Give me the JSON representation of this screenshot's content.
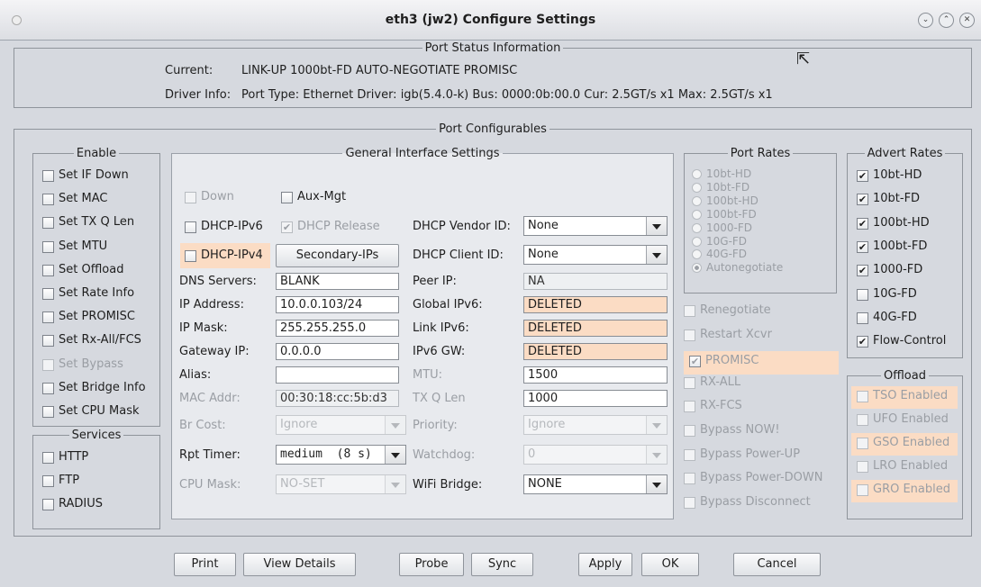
{
  "window": {
    "title": "eth3  (jw2) Configure Settings"
  },
  "status": {
    "section_title": "Port Status Information",
    "current_label": "Current:",
    "current_value": "LINK-UP 1000bt-FD AUTO-NEGOTIATE PROMISC",
    "driver_label": "Driver Info:",
    "driver_value": "Port Type: Ethernet   Driver: igb(5.4.0-k)  Bus: 0000:0b:00.0  Cur: 2.5GT/s x1   Max: 2.5GT/s x1"
  },
  "configurables": {
    "title": "Port Configurables"
  },
  "enable": {
    "title": "Enable",
    "items": [
      {
        "label": "Set IF Down",
        "checked": false,
        "disabled": false
      },
      {
        "label": "Set MAC",
        "checked": false,
        "disabled": false
      },
      {
        "label": "Set TX Q Len",
        "checked": false,
        "disabled": false
      },
      {
        "label": "Set MTU",
        "checked": false,
        "disabled": false
      },
      {
        "label": "Set Offload",
        "checked": false,
        "disabled": false
      },
      {
        "label": "Set Rate Info",
        "checked": false,
        "disabled": false
      },
      {
        "label": "Set PROMISC",
        "checked": false,
        "disabled": false
      },
      {
        "label": "Set Rx-All/FCS",
        "checked": false,
        "disabled": false
      },
      {
        "label": "Set Bypass",
        "checked": false,
        "disabled": true
      },
      {
        "label": "Set Bridge Info",
        "checked": false,
        "disabled": false
      },
      {
        "label": "Set CPU Mask",
        "checked": false,
        "disabled": false
      }
    ]
  },
  "services": {
    "title": "Services",
    "items": [
      {
        "label": "HTTP",
        "checked": false
      },
      {
        "label": "FTP",
        "checked": false
      },
      {
        "label": "RADIUS",
        "checked": false
      }
    ]
  },
  "general": {
    "title": "General Interface Settings",
    "down_label": "Down",
    "aux_mgt_label": "Aux-Mgt",
    "dhcp_ipv6_label": "DHCP-IPv6",
    "dhcp_release_label": "DHCP Release",
    "dhcp_vendor_label": "DHCP Vendor ID:",
    "dhcp_vendor_value": "None",
    "dhcp_ipv4_label": "DHCP-IPv4",
    "secondary_ips_label": "Secondary-IPs",
    "dhcp_client_label": "DHCP Client ID:",
    "dhcp_client_value": "None",
    "dns_label": "DNS Servers:",
    "dns_value": "BLANK",
    "peer_ip_label": "Peer IP:",
    "peer_ip_value": "NA",
    "ip_label": "IP Address:",
    "ip_value": "10.0.0.103/24",
    "global_ipv6_label": "Global IPv6:",
    "global_ipv6_value": "DELETED",
    "mask_label": "IP Mask:",
    "mask_value": "255.255.255.0",
    "link_ipv6_label": "Link IPv6:",
    "link_ipv6_value": "DELETED",
    "gw_label": "Gateway IP:",
    "gw_value": "0.0.0.0",
    "ipv6_gw_label": "IPv6 GW:",
    "ipv6_gw_value": "DELETED",
    "alias_label": "Alias:",
    "alias_value": "",
    "mtu_label": "MTU:",
    "mtu_value": "1500",
    "mac_label": "MAC Addr:",
    "mac_value": "00:30:18:cc:5b:d3",
    "txq_label": "TX Q Len",
    "txq_value": "1000",
    "br_cost_label": "Br Cost:",
    "br_cost_value": "Ignore",
    "priority_label": "Priority:",
    "priority_value": "Ignore",
    "rpt_timer_label": "Rpt Timer:",
    "rpt_timer_value": "medium  (8 s)",
    "watchdog_label": "Watchdog:",
    "watchdog_value": "0",
    "cpu_mask_label": "CPU Mask:",
    "cpu_mask_value": "NO-SET",
    "wifi_bridge_label": "WiFi Bridge:",
    "wifi_bridge_value": "NONE"
  },
  "port_rates": {
    "title": "Port Rates",
    "options": [
      "10bt-HD",
      "10bt-FD",
      "100bt-HD",
      "100bt-FD",
      "1000-FD",
      "10G-FD",
      "40G-FD",
      "Autonegotiate"
    ],
    "selected": "Autonegotiate"
  },
  "port_options": [
    {
      "label": "Renegotiate",
      "checked": false,
      "highlight": false
    },
    {
      "label": "Restart Xcvr",
      "checked": false,
      "highlight": false
    },
    {
      "label": "PROMISC",
      "checked": true,
      "highlight": true
    },
    {
      "label": "RX-ALL",
      "checked": false,
      "highlight": false
    },
    {
      "label": "RX-FCS",
      "checked": false,
      "highlight": false
    },
    {
      "label": "Bypass NOW!",
      "checked": false,
      "highlight": false
    },
    {
      "label": "Bypass Power-UP",
      "checked": false,
      "highlight": false
    },
    {
      "label": "Bypass Power-DOWN",
      "checked": false,
      "highlight": false
    },
    {
      "label": "Bypass Disconnect",
      "checked": false,
      "highlight": false
    }
  ],
  "advert_rates": {
    "title": "Advert Rates",
    "items": [
      {
        "label": "10bt-HD",
        "checked": true
      },
      {
        "label": "10bt-FD",
        "checked": true
      },
      {
        "label": "100bt-HD",
        "checked": true
      },
      {
        "label": "100bt-FD",
        "checked": true
      },
      {
        "label": "1000-FD",
        "checked": true
      },
      {
        "label": "10G-FD",
        "checked": false
      },
      {
        "label": "40G-FD",
        "checked": false
      },
      {
        "label": "Flow-Control",
        "checked": true
      }
    ]
  },
  "offload": {
    "title": "Offload",
    "items": [
      {
        "label": "TSO Enabled",
        "highlight": true
      },
      {
        "label": "UFO Enabled",
        "highlight": false
      },
      {
        "label": "GSO Enabled",
        "highlight": true
      },
      {
        "label": "LRO Enabled",
        "highlight": false
      },
      {
        "label": "GRO Enabled",
        "highlight": true
      }
    ]
  },
  "buttons": {
    "print": "Print",
    "view_details": "View Details",
    "probe": "Probe",
    "sync": "Sync",
    "apply": "Apply",
    "ok": "OK",
    "cancel": "Cancel"
  },
  "colors": {
    "highlight": "#fbdcc4",
    "panel": "#e8eaee"
  }
}
